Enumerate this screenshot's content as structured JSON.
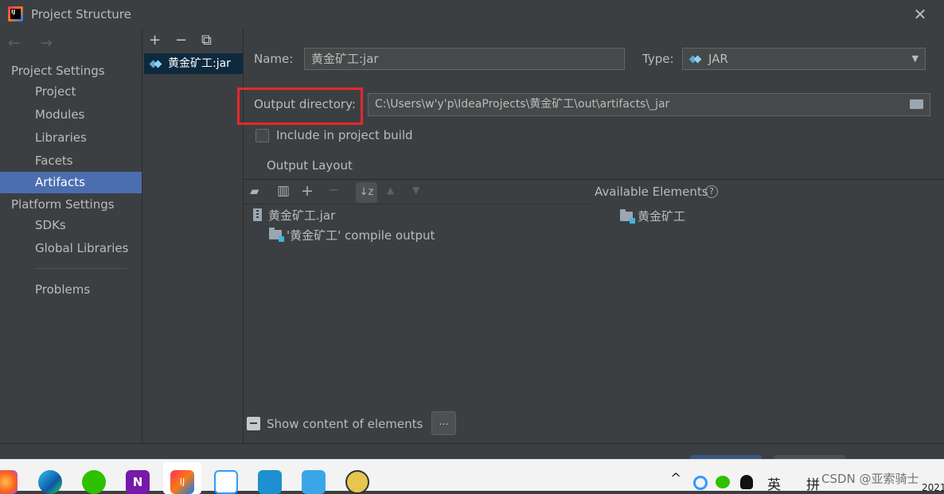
{
  "window": {
    "title": "Project Structure",
    "close_glyph": "✕"
  },
  "nav": {
    "back_forward": "← →",
    "sections": [
      {
        "heading": "Project Settings",
        "items": [
          "Project",
          "Modules",
          "Libraries",
          "Facets",
          "Artifacts"
        ]
      },
      {
        "heading": "Platform Settings",
        "items": [
          "SDKs",
          "Global Libraries"
        ]
      }
    ],
    "problems": "Problems",
    "selected": "Artifacts"
  },
  "artifact_list": {
    "toolbar": {
      "add": "+",
      "remove": "−",
      "copy": "⧉"
    },
    "items": [
      "黄金矿工:jar"
    ]
  },
  "form": {
    "name_label": "Name:",
    "name_value": "黄金矿工:jar",
    "type_label": "Type:",
    "type_value": "JAR",
    "output_dir_label": "Output directory:",
    "output_dir_value": "C:\\Users\\w'y'p\\IdeaProjects\\黄金矿工\\out\\artifacts\\_jar",
    "include_build_label": "Include in project build",
    "include_build_checked": false
  },
  "output_layout": {
    "tab_label": "Output Layout",
    "tree": [
      {
        "label": "黄金矿工.jar",
        "icon": "jar-icon",
        "depth": 0
      },
      {
        "label": "'黄金矿工' compile output",
        "icon": "module-output-icon",
        "depth": 1
      }
    ],
    "available_label": "Available Elements",
    "available_items": [
      "黄金矿工"
    ],
    "help_glyph": "?"
  },
  "bottom": {
    "show_content_label": "Show content of elements",
    "show_content_checked": true,
    "more_button": "..."
  },
  "taskbar": {
    "tray_ime": "英",
    "tray_pinyin": "拼",
    "tray_chevron": "^",
    "clock_fragment": "2021"
  },
  "watermark": "CSDN @亚索骑士",
  "colors": {
    "background": "#3c3f41",
    "selection": "#4b6eaf",
    "highlight_box": "#e8272d",
    "text": "#bbbbbb"
  }
}
